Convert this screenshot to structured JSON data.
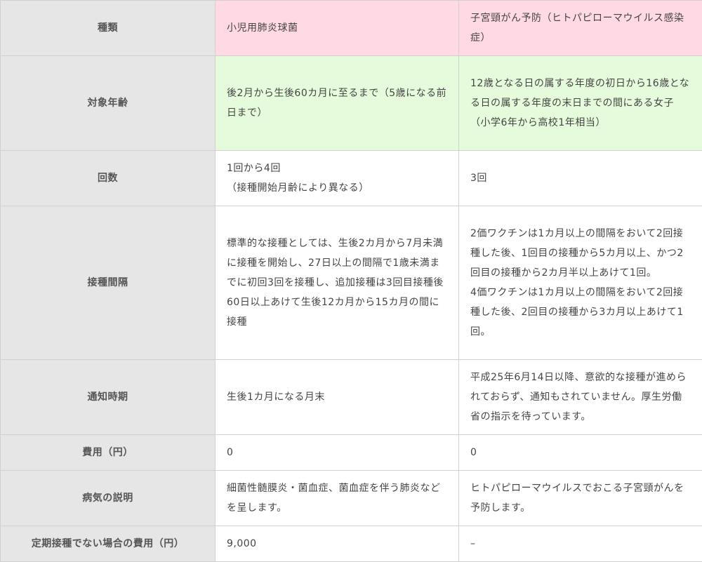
{
  "table": {
    "header": {
      "label": "種類",
      "col_a": "小児用肺炎球菌",
      "col_b": "子宮頸がん予防（ヒトパピローマウイルス感染症）"
    },
    "rows": [
      {
        "label": "対象年齢",
        "a": "後2月から生後60カ月に至るまで（5歳になる前日まで）",
        "b": "12歳となる日の属する年度の初日から16歳となる日の属する年度の末日までの間にある女子\n（小学6年から高校1年相当）"
      },
      {
        "label": "回数",
        "a": "1回から4回\n（接種開始月齢により異なる）",
        "b": "3回"
      },
      {
        "label": "接種間隔",
        "a": "標準的な接種としては、生後2カ月から7月未満に接種を開始し、27日以上の間隔で1歳未満までに初回3回を接種し、追加接種は3回目接種後60日以上あけて生後12カ月から15カ月の間に接種",
        "b": "2価ワクチンは1カ月以上の間隔をおいて2回接種した後、1回目の接種から5カ月以上、かつ2回目の接種から2カ月半以上あけて1回。\n4価ワクチンは1カ月以上の間隔をおいて2回接種した後、2回目の接種から3カ月以上あけて1回。"
      },
      {
        "label": "通知時期",
        "a": "生後1カ月になる月末",
        "b": "平成25年6月14日以降、意欲的な接種が進められておらず、通知もされていません。厚生労働省の指示を待っています。"
      },
      {
        "label": "費用（円）",
        "a": "0",
        "b": "0"
      },
      {
        "label": "病気の説明",
        "a": "細菌性髄膜炎・菌血症、菌血症を伴う肺炎などを呈します。",
        "b": "ヒトパピローマウイルスでおこる子宮頸がんを予防します。"
      },
      {
        "label": "定期接種でない場合の費用（円）",
        "a": "9,000",
        "b": "–"
      }
    ]
  },
  "colors": {
    "header_bg": "#e6e6e6",
    "pink_row": "#ffd9e3",
    "green_row": "#e6fbdc",
    "border": "#d0d0d0"
  }
}
